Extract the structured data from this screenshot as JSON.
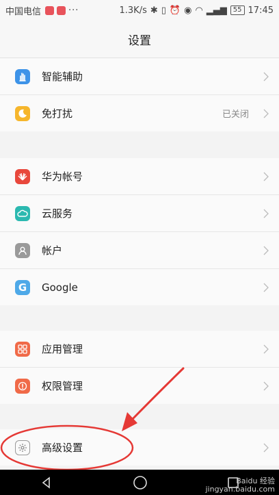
{
  "status_bar": {
    "carrier": "中国电信",
    "dots": "···",
    "speed": "1.3K/s",
    "battery": "55",
    "time": "17:45"
  },
  "header": {
    "title": "设置"
  },
  "groups": [
    {
      "items": [
        {
          "label": "智能辅助",
          "icon": "hand-icon",
          "color": "#3d93e8"
        },
        {
          "label": "免打扰",
          "value": "已关闭",
          "icon": "moon-icon",
          "color": "#f6b62c"
        }
      ]
    },
    {
      "items": [
        {
          "label": "华为帐号",
          "icon": "huawei-icon",
          "color": "#e8483c"
        },
        {
          "label": "云服务",
          "icon": "cloud-icon",
          "color": "#2bb9b0"
        },
        {
          "label": "帐户",
          "icon": "account-icon",
          "color": "#9a9a9a"
        },
        {
          "label": "Google",
          "icon": "google-icon",
          "color": "#4ea9e8"
        }
      ]
    },
    {
      "items": [
        {
          "label": "应用管理",
          "icon": "apps-icon",
          "color": "#f06a48"
        },
        {
          "label": "权限管理",
          "icon": "permission-icon",
          "color": "#f06a48"
        }
      ]
    },
    {
      "items": [
        {
          "label": "高级设置",
          "icon": "gear-icon",
          "color": "#8c8c8c"
        }
      ]
    }
  ],
  "watermark": {
    "line1": "Baidu 经验",
    "line2": "jingyan.baidu.com"
  },
  "annotation_color": "#e53935"
}
